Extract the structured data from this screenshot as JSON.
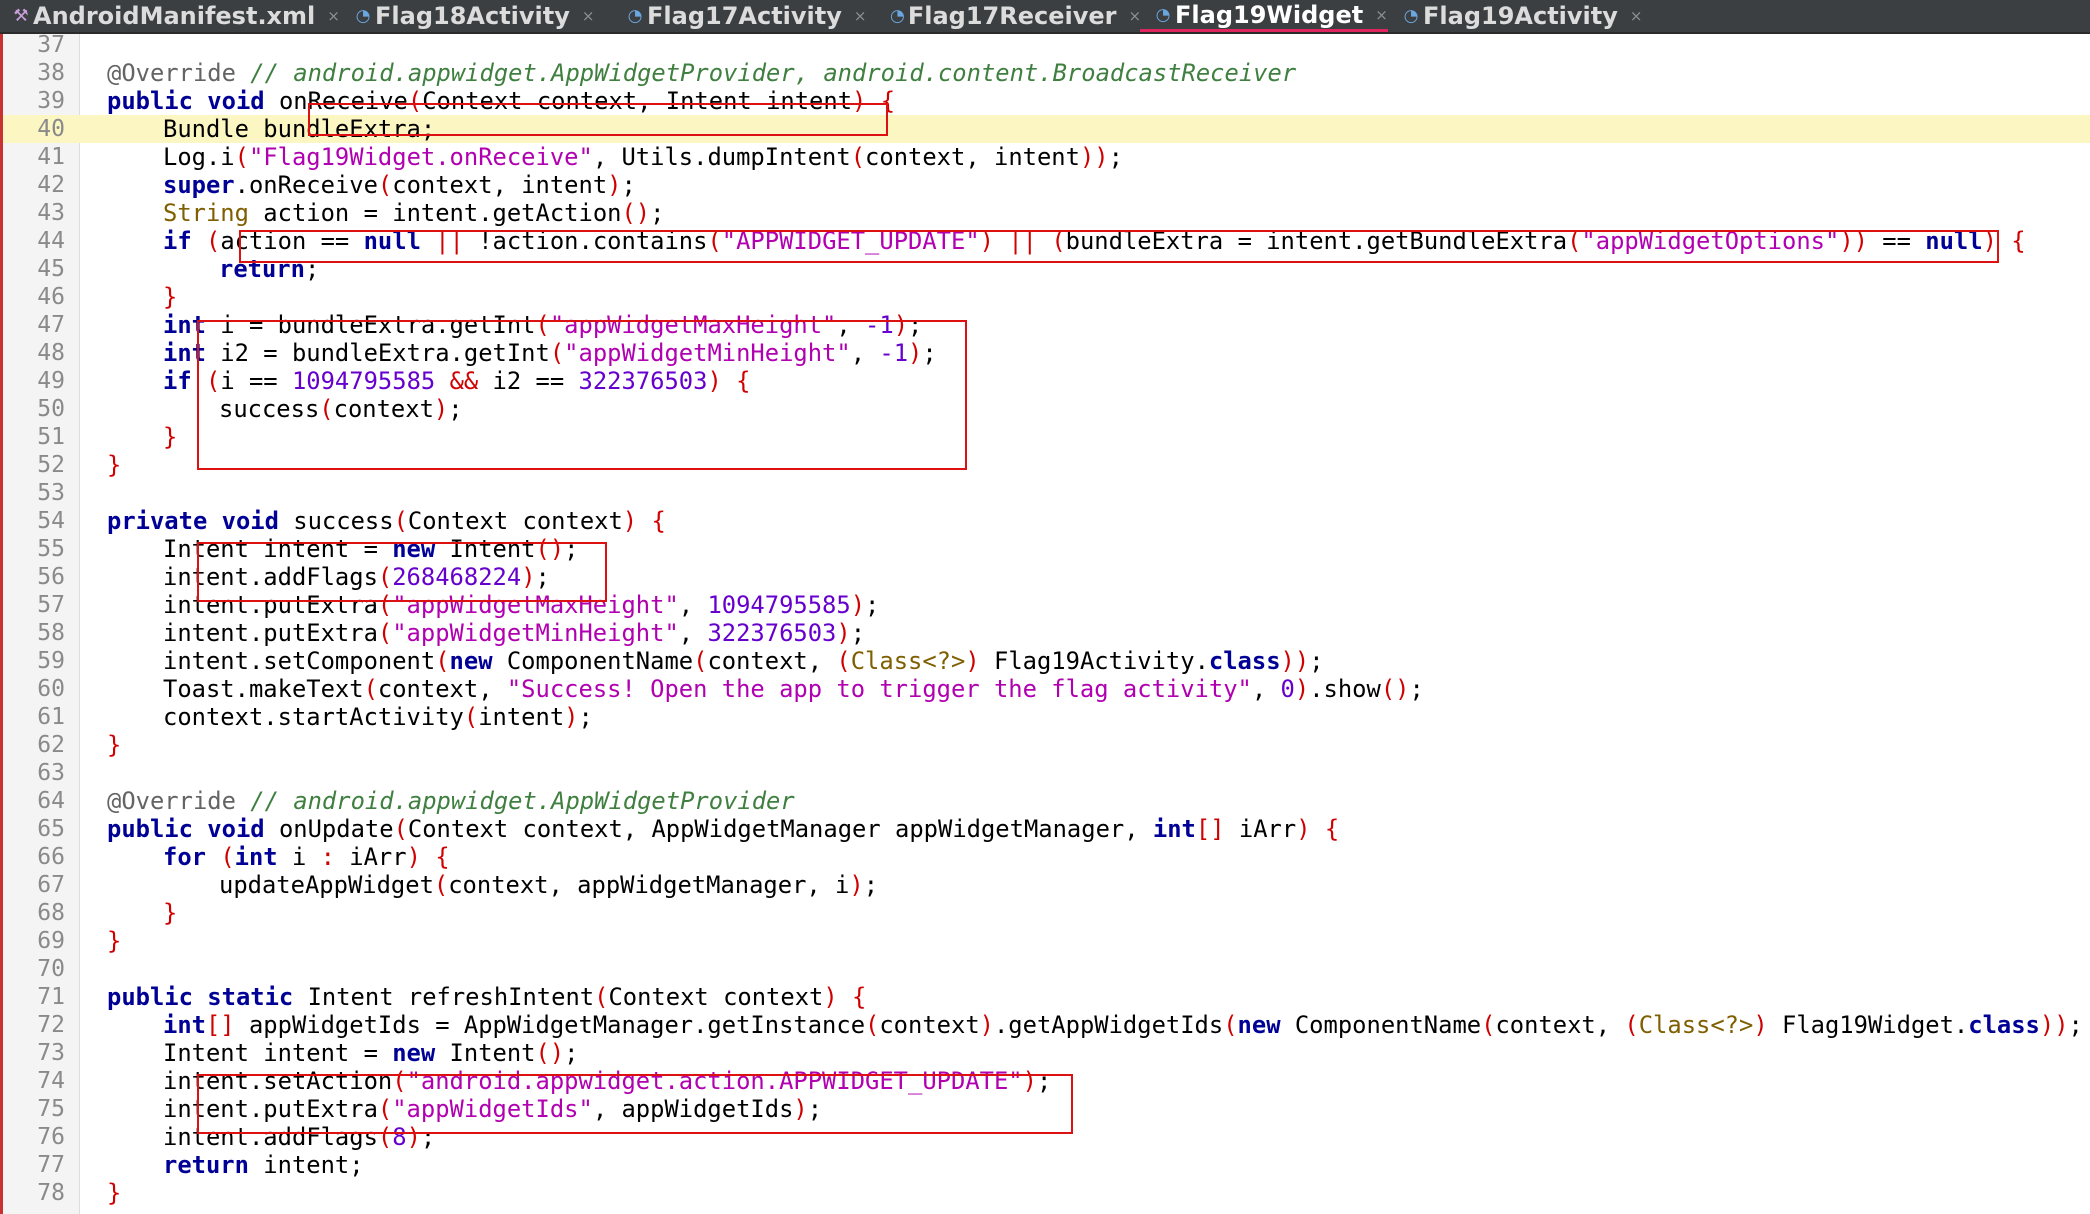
{
  "tabs": [
    {
      "label": "AndroidManifest.xml",
      "icon": "xml-file-icon",
      "active": false
    },
    {
      "label": "Flag18Activity",
      "icon": "java-class-icon",
      "active": false
    },
    {
      "label": "Flag17Activity",
      "icon": "java-class-icon",
      "active": false
    },
    {
      "label": "Flag17Receiver",
      "icon": "java-class-icon",
      "active": false
    },
    {
      "label": "Flag19Widget",
      "icon": "java-class-icon",
      "active": true
    },
    {
      "label": "Flag19Activity",
      "icon": "java-class-icon",
      "active": false
    }
  ],
  "colors": {
    "keyword": "#000096",
    "string": "#b000b0",
    "number": "#6600cc",
    "comment": "#3f7f3f",
    "annotation": "#646464",
    "bracket": "#d00000",
    "current_line": "#fbf6c2",
    "highlight_box": "#dd1111"
  },
  "editor": {
    "current_line": 40,
    "lines": [
      {
        "n": "37",
        "indent": 0,
        "tokens": []
      },
      {
        "n": "38",
        "indent": 1,
        "tokens": [
          [
            "ann",
            "@Override "
          ],
          [
            "cm",
            "// android.appwidget.AppWidgetProvider, android.content.BroadcastReceiver"
          ]
        ]
      },
      {
        "n": "39",
        "indent": 1,
        "tokens": [
          [
            "kw",
            "public void "
          ],
          [
            "",
            "onReceive"
          ],
          [
            "br",
            "("
          ],
          [
            "",
            "Context context, Intent intent"
          ],
          [
            "br",
            ")"
          ],
          [
            "",
            " "
          ],
          [
            "br",
            "{"
          ]
        ]
      },
      {
        "n": "40",
        "indent": 2,
        "tokens": [
          [
            "",
            "Bundle bundleExtra;"
          ]
        ]
      },
      {
        "n": "41",
        "indent": 2,
        "tokens": [
          [
            "",
            "Log.i"
          ],
          [
            "br",
            "("
          ],
          [
            "str",
            "\"Flag19Widget.onReceive\""
          ],
          [
            "",
            ", Utils.dumpIntent"
          ],
          [
            "br",
            "("
          ],
          [
            "",
            "context, intent"
          ],
          [
            "br",
            "))"
          ],
          [
            "",
            ";"
          ]
        ]
      },
      {
        "n": "42",
        "indent": 2,
        "tokens": [
          [
            "kw",
            "super"
          ],
          [
            "",
            ".onReceive"
          ],
          [
            "br",
            "("
          ],
          [
            "",
            "context, intent"
          ],
          [
            "br",
            ")"
          ],
          [
            "",
            ";"
          ]
        ]
      },
      {
        "n": "43",
        "indent": 2,
        "tokens": [
          [
            "ty",
            "String"
          ],
          [
            "",
            " action = intent.getAction"
          ],
          [
            "br",
            "()"
          ],
          [
            "",
            ";"
          ]
        ]
      },
      {
        "n": "44",
        "indent": 2,
        "tokens": [
          [
            "kw",
            "if "
          ],
          [
            "br",
            "("
          ],
          [
            "",
            "action == "
          ],
          [
            "kw",
            "null"
          ],
          [
            "",
            " "
          ],
          [
            "br",
            "||"
          ],
          [
            "",
            " !action.contains"
          ],
          [
            "br",
            "("
          ],
          [
            "str",
            "\"APPWIDGET_UPDATE\""
          ],
          [
            "br",
            ")"
          ],
          [
            "",
            " "
          ],
          [
            "br",
            "||"
          ],
          [
            "",
            " "
          ],
          [
            "br",
            "("
          ],
          [
            "",
            "bundleExtra = intent.getBundleExtra"
          ],
          [
            "br",
            "("
          ],
          [
            "str",
            "\"appWidgetOptions\""
          ],
          [
            "br",
            "))"
          ],
          [
            "",
            " == "
          ],
          [
            "kw",
            "null"
          ],
          [
            "br",
            ")"
          ],
          [
            "",
            " "
          ],
          [
            "br",
            "{"
          ]
        ]
      },
      {
        "n": "45",
        "indent": 3,
        "tokens": [
          [
            "kw",
            "return"
          ],
          [
            "",
            ";"
          ]
        ]
      },
      {
        "n": "46",
        "indent": 2,
        "tokens": [
          [
            "br",
            "}"
          ]
        ]
      },
      {
        "n": "47",
        "indent": 2,
        "tokens": [
          [
            "kw",
            "int"
          ],
          [
            "",
            " i = bundleExtra.getInt"
          ],
          [
            "br",
            "("
          ],
          [
            "str",
            "\"appWidgetMaxHeight\""
          ],
          [
            "",
            ", "
          ],
          [
            "num",
            "-1"
          ],
          [
            "br",
            ")"
          ],
          [
            "",
            ";"
          ]
        ]
      },
      {
        "n": "48",
        "indent": 2,
        "tokens": [
          [
            "kw",
            "int"
          ],
          [
            "",
            " i2 = bundleExtra.getInt"
          ],
          [
            "br",
            "("
          ],
          [
            "str",
            "\"appWidgetMinHeight\""
          ],
          [
            "",
            ", "
          ],
          [
            "num",
            "-1"
          ],
          [
            "br",
            ")"
          ],
          [
            "",
            ";"
          ]
        ]
      },
      {
        "n": "49",
        "indent": 2,
        "tokens": [
          [
            "kw",
            "if "
          ],
          [
            "br",
            "("
          ],
          [
            "",
            "i == "
          ],
          [
            "num",
            "1094795585"
          ],
          [
            "",
            " "
          ],
          [
            "br",
            "&&"
          ],
          [
            "",
            " i2 == "
          ],
          [
            "num",
            "322376503"
          ],
          [
            "br",
            ")"
          ],
          [
            "",
            " "
          ],
          [
            "br",
            "{"
          ]
        ]
      },
      {
        "n": "50",
        "indent": 3,
        "tokens": [
          [
            "",
            "success"
          ],
          [
            "br",
            "("
          ],
          [
            "",
            "context"
          ],
          [
            "br",
            ")"
          ],
          [
            "",
            ";"
          ]
        ]
      },
      {
        "n": "51",
        "indent": 2,
        "tokens": [
          [
            "br",
            "}"
          ]
        ]
      },
      {
        "n": "52",
        "indent": 1,
        "tokens": [
          [
            "br",
            "}"
          ]
        ]
      },
      {
        "n": "53",
        "indent": 0,
        "tokens": []
      },
      {
        "n": "54",
        "indent": 1,
        "tokens": [
          [
            "kw",
            "private void "
          ],
          [
            "",
            "success"
          ],
          [
            "br",
            "("
          ],
          [
            "",
            "Context context"
          ],
          [
            "br",
            ")"
          ],
          [
            "",
            " "
          ],
          [
            "br",
            "{"
          ]
        ]
      },
      {
        "n": "55",
        "indent": 2,
        "tokens": [
          [
            "",
            "Intent intent = "
          ],
          [
            "kw",
            "new"
          ],
          [
            "",
            " Intent"
          ],
          [
            "br",
            "()"
          ],
          [
            "",
            ";"
          ]
        ]
      },
      {
        "n": "56",
        "indent": 2,
        "tokens": [
          [
            "",
            "intent.addFlags"
          ],
          [
            "br",
            "("
          ],
          [
            "num",
            "268468224"
          ],
          [
            "br",
            ")"
          ],
          [
            "",
            ";"
          ]
        ]
      },
      {
        "n": "57",
        "indent": 2,
        "tokens": [
          [
            "",
            "intent.putExtra"
          ],
          [
            "br",
            "("
          ],
          [
            "str",
            "\"appWidgetMaxHeight\""
          ],
          [
            "",
            ", "
          ],
          [
            "num",
            "1094795585"
          ],
          [
            "br",
            ")"
          ],
          [
            "",
            ";"
          ]
        ]
      },
      {
        "n": "58",
        "indent": 2,
        "tokens": [
          [
            "",
            "intent.putExtra"
          ],
          [
            "br",
            "("
          ],
          [
            "str",
            "\"appWidgetMinHeight\""
          ],
          [
            "",
            ", "
          ],
          [
            "num",
            "322376503"
          ],
          [
            "br",
            ")"
          ],
          [
            "",
            ";"
          ]
        ]
      },
      {
        "n": "59",
        "indent": 2,
        "tokens": [
          [
            "",
            "intent.setComponent"
          ],
          [
            "br",
            "("
          ],
          [
            "kw",
            "new"
          ],
          [
            "",
            " ComponentName"
          ],
          [
            "br",
            "("
          ],
          [
            "",
            "context, "
          ],
          [
            "br",
            "("
          ],
          [
            "ty",
            "Class<?>"
          ],
          [
            "br",
            ")"
          ],
          [
            "",
            " Flag19Activity."
          ],
          [
            "kw",
            "class"
          ],
          [
            "br",
            "))"
          ],
          [
            "",
            ";"
          ]
        ]
      },
      {
        "n": "60",
        "indent": 2,
        "tokens": [
          [
            "",
            "Toast.makeText"
          ],
          [
            "br",
            "("
          ],
          [
            "",
            "context, "
          ],
          [
            "str",
            "\"Success! Open the app to trigger the flag activity\""
          ],
          [
            "",
            ", "
          ],
          [
            "num",
            "0"
          ],
          [
            "br",
            ")"
          ],
          [
            "",
            ".show"
          ],
          [
            "br",
            "()"
          ],
          [
            "",
            ";"
          ]
        ]
      },
      {
        "n": "61",
        "indent": 2,
        "tokens": [
          [
            "",
            "context.startActivity"
          ],
          [
            "br",
            "("
          ],
          [
            "",
            "intent"
          ],
          [
            "br",
            ")"
          ],
          [
            "",
            ";"
          ]
        ]
      },
      {
        "n": "62",
        "indent": 1,
        "tokens": [
          [
            "br",
            "}"
          ]
        ]
      },
      {
        "n": "63",
        "indent": 0,
        "tokens": []
      },
      {
        "n": "64",
        "indent": 1,
        "tokens": [
          [
            "ann",
            "@Override "
          ],
          [
            "cm",
            "// android.appwidget.AppWidgetProvider"
          ]
        ]
      },
      {
        "n": "65",
        "indent": 1,
        "tokens": [
          [
            "kw",
            "public void "
          ],
          [
            "",
            "onUpdate"
          ],
          [
            "br",
            "("
          ],
          [
            "",
            "Context context, AppWidgetManager appWidgetManager, "
          ],
          [
            "kw",
            "int"
          ],
          [
            "br",
            "[]"
          ],
          [
            "",
            " iArr"
          ],
          [
            "br",
            ")"
          ],
          [
            "",
            " "
          ],
          [
            "br",
            "{"
          ]
        ]
      },
      {
        "n": "66",
        "indent": 2,
        "tokens": [
          [
            "kw",
            "for "
          ],
          [
            "br",
            "("
          ],
          [
            "kw",
            "int"
          ],
          [
            "",
            " i "
          ],
          [
            "br",
            ":"
          ],
          [
            "",
            " iArr"
          ],
          [
            "br",
            ")"
          ],
          [
            "",
            " "
          ],
          [
            "br",
            "{"
          ]
        ]
      },
      {
        "n": "67",
        "indent": 3,
        "tokens": [
          [
            "",
            "updateAppWidget"
          ],
          [
            "br",
            "("
          ],
          [
            "",
            "context, appWidgetManager, i"
          ],
          [
            "br",
            ")"
          ],
          [
            "",
            ";"
          ]
        ]
      },
      {
        "n": "68",
        "indent": 2,
        "tokens": [
          [
            "br",
            "}"
          ]
        ]
      },
      {
        "n": "69",
        "indent": 1,
        "tokens": [
          [
            "br",
            "}"
          ]
        ]
      },
      {
        "n": "70",
        "indent": 0,
        "tokens": []
      },
      {
        "n": "71",
        "indent": 1,
        "tokens": [
          [
            "kw",
            "public static "
          ],
          [
            "",
            "Intent refreshIntent"
          ],
          [
            "br",
            "("
          ],
          [
            "",
            "Context context"
          ],
          [
            "br",
            ")"
          ],
          [
            "",
            " "
          ],
          [
            "br",
            "{"
          ]
        ]
      },
      {
        "n": "72",
        "indent": 2,
        "tokens": [
          [
            "kw",
            "int"
          ],
          [
            "br",
            "[]"
          ],
          [
            "",
            " appWidgetIds = AppWidgetManager.getInstance"
          ],
          [
            "br",
            "("
          ],
          [
            "",
            "context"
          ],
          [
            "br",
            ")"
          ],
          [
            "",
            ".getAppWidgetIds"
          ],
          [
            "br",
            "("
          ],
          [
            "kw",
            "new"
          ],
          [
            "",
            " ComponentName"
          ],
          [
            "br",
            "("
          ],
          [
            "",
            "context, "
          ],
          [
            "br",
            "("
          ],
          [
            "ty",
            "Class<?>"
          ],
          [
            "br",
            ")"
          ],
          [
            "",
            " Flag19Widget."
          ],
          [
            "kw",
            "class"
          ],
          [
            "br",
            "))"
          ],
          [
            "",
            ";"
          ]
        ]
      },
      {
        "n": "73",
        "indent": 2,
        "tokens": [
          [
            "",
            "Intent intent = "
          ],
          [
            "kw",
            "new"
          ],
          [
            "",
            " Intent"
          ],
          [
            "br",
            "()"
          ],
          [
            "",
            ";"
          ]
        ]
      },
      {
        "n": "74",
        "indent": 2,
        "tokens": [
          [
            "",
            "intent.setAction"
          ],
          [
            "br",
            "("
          ],
          [
            "str",
            "\"android.appwidget.action.APPWIDGET_UPDATE\""
          ],
          [
            "br",
            ")"
          ],
          [
            "",
            ";"
          ]
        ]
      },
      {
        "n": "75",
        "indent": 2,
        "tokens": [
          [
            "",
            "intent.putExtra"
          ],
          [
            "br",
            "("
          ],
          [
            "str",
            "\"appWidgetIds\""
          ],
          [
            "",
            ", appWidgetIds"
          ],
          [
            "br",
            ")"
          ],
          [
            "",
            ";"
          ]
        ]
      },
      {
        "n": "76",
        "indent": 2,
        "tokens": [
          [
            "",
            "intent.addFlags"
          ],
          [
            "br",
            "("
          ],
          [
            "num",
            "8"
          ],
          [
            "br",
            ")"
          ],
          [
            "",
            ";"
          ]
        ]
      },
      {
        "n": "77",
        "indent": 2,
        "tokens": [
          [
            "kw",
            "return"
          ],
          [
            "",
            " intent;"
          ]
        ]
      },
      {
        "n": "78",
        "indent": 1,
        "tokens": [
          [
            "br",
            "}"
          ]
        ]
      }
    ]
  }
}
